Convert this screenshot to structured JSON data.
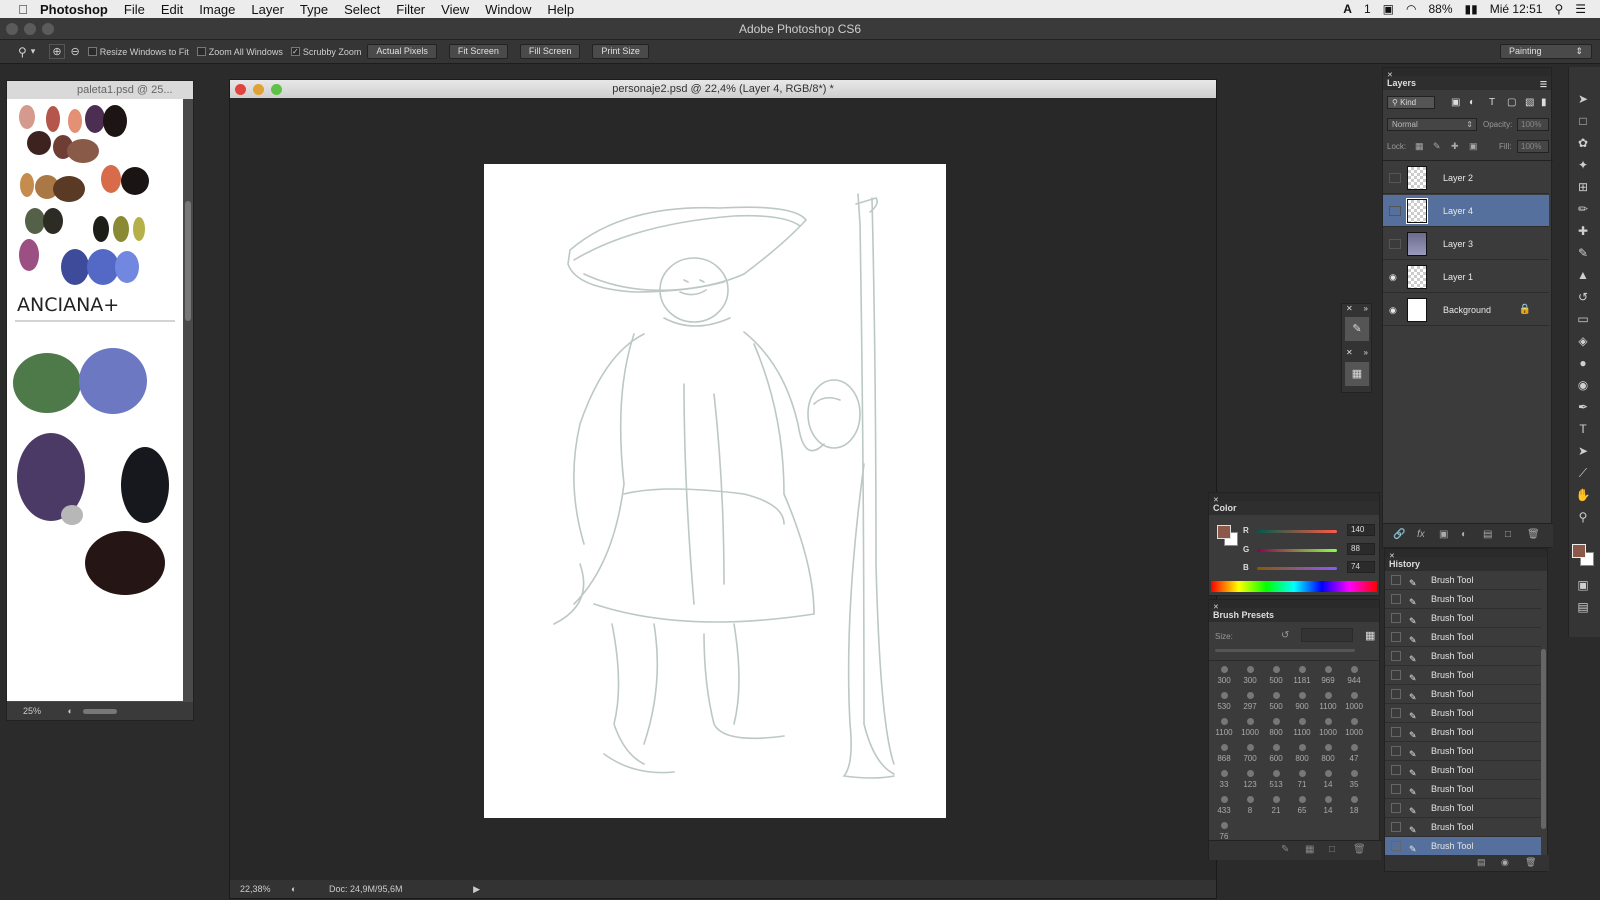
{
  "menubar": {
    "app": "Photoshop",
    "items": [
      "File",
      "Edit",
      "Image",
      "Layer",
      "Type",
      "Select",
      "Filter",
      "View",
      "Window",
      "Help"
    ],
    "status_extra": "1",
    "battery": "88%",
    "clock": "Mié 12:51"
  },
  "window_title": "Adobe Photoshop CS6",
  "options": {
    "resize_windows": "Resize Windows to Fit",
    "zoom_all": "Zoom All Windows",
    "scrubby_zoom": "Scrubby Zoom",
    "actual_pixels": "Actual Pixels",
    "fit_screen": "Fit Screen",
    "fill_screen": "Fill Screen",
    "print_size": "Print Size",
    "workspace": "Painting"
  },
  "palette_doc": {
    "title": "paleta1.psd @ 25...",
    "zoom": "25%",
    "handwriting": "ANCIANA+"
  },
  "main_doc": {
    "title": "personaje2.psd @ 22,4% (Layer 4, RGB/8*) *",
    "zoom": "22,38%",
    "doc_size": "Doc: 24,9M/95,6M"
  },
  "layers": {
    "tab": "Layers",
    "kind": "Kind",
    "blend": "Normal",
    "opacity_label": "Opacity:",
    "opacity_value": "100%",
    "lock_label": "Lock:",
    "fill_label": "Fill:",
    "fill_value": "100%",
    "items": [
      {
        "name": "Layer 2",
        "visible": false,
        "selected": false
      },
      {
        "name": "Layer 4",
        "visible": false,
        "selected": true
      },
      {
        "name": "Layer 3",
        "visible": false,
        "selected": false
      },
      {
        "name": "Layer 1",
        "visible": true,
        "selected": false
      },
      {
        "name": "Background",
        "visible": true,
        "selected": false
      }
    ]
  },
  "color": {
    "tab": "Color",
    "r_label": "R",
    "r": "140",
    "g_label": "G",
    "g": "88",
    "b_label": "B",
    "b": "74",
    "foreground": "#8c584a"
  },
  "brush_presets": {
    "tab": "Brush Presets",
    "size_label": "Size:",
    "sizes": [
      "300",
      "300",
      "500",
      "1181",
      "969",
      "944",
      "530",
      "297",
      "500",
      "900",
      "1100",
      "1000",
      "1100",
      "1000",
      "800",
      "1100",
      "1000",
      "1000",
      "868",
      "700",
      "600",
      "800",
      "800",
      "47",
      "33",
      "123",
      "513",
      "71",
      "14",
      "35",
      "433",
      "8",
      "21",
      "65",
      "14",
      "18",
      "76"
    ]
  },
  "history": {
    "tab": "History",
    "items": [
      "Brush Tool",
      "Brush Tool",
      "Brush Tool",
      "Brush Tool",
      "Brush Tool",
      "Brush Tool",
      "Brush Tool",
      "Brush Tool",
      "Brush Tool",
      "Brush Tool",
      "Brush Tool",
      "Brush Tool",
      "Brush Tool",
      "Brush Tool",
      "Brush Tool"
    ]
  },
  "colors": {
    "selection": "#55709c",
    "foreground_swatch": "#8c584a"
  }
}
